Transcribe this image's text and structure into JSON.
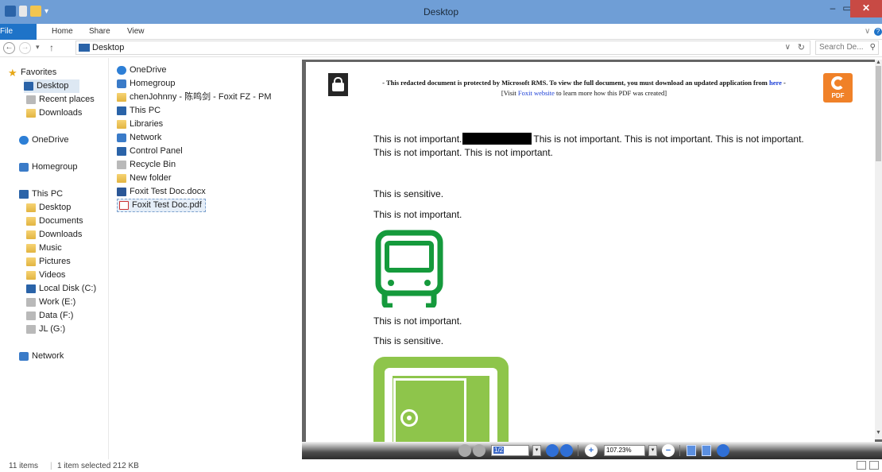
{
  "window": {
    "title": "Desktop",
    "controls": {
      "minimize": "–",
      "maximize": "▭",
      "close": "✕"
    }
  },
  "ribbon": {
    "tabs": [
      "File",
      "Home",
      "Share",
      "View"
    ]
  },
  "address": {
    "path": "Desktop",
    "search_placeholder": "Search De...",
    "dropdown": "∨",
    "refresh": "↻"
  },
  "nav": {
    "back": "←",
    "forward": "→",
    "recent": "▾",
    "up": "↑"
  },
  "sidebar": {
    "favorites": {
      "label": "Favorites",
      "items": [
        "Desktop",
        "Recent places",
        "Downloads"
      ]
    },
    "onedrive": "OneDrive",
    "homegroup": "Homegroup",
    "thispc": {
      "label": "This PC",
      "items": [
        "Desktop",
        "Documents",
        "Downloads",
        "Music",
        "Pictures",
        "Videos",
        "Local Disk (C:)",
        "Work (E:)",
        "Data (F:)",
        "JL (G:)"
      ]
    },
    "network": "Network"
  },
  "files": [
    "OneDrive",
    "Homegroup",
    "chenJohnny - 陈鸣剑 - Foxit FZ - PM",
    "This PC",
    "Libraries",
    "Network",
    "Control Panel",
    "Recycle Bin",
    "New folder",
    "Foxit Test Doc.docx",
    "Foxit Test Doc.pdf"
  ],
  "status": {
    "count": "11 items",
    "selected": "1 item selected  212 KB"
  },
  "preview": {
    "notice_prefix": "-  This redacted document is protected by Microsoft RMS. To view the full document, you must download an updated application from ",
    "notice_link": "here",
    "notice_suffix": " -",
    "visit_prefix": "[Visit ",
    "visit_link": "Foxit website",
    "visit_suffix": " to learn more how this PDF was created]",
    "foxit_label": "PDF",
    "para1_a": "This is not important.",
    "para1_b": "This is not important. This is not important. This is not important.",
    "para1_c": "This is not important. This is not important.",
    "line_sensitive_1": "This is sensitive.",
    "line_not_important_1": "This is not important.",
    "line_not_important_2": "This is not important.",
    "line_sensitive_2": "This is sensitive.",
    "page_field": "1/2",
    "zoom_field": "107.23%",
    "colors": {
      "bus": "#159a3c",
      "safe": "#8ec54b",
      "accent": "#1e73c8"
    }
  }
}
